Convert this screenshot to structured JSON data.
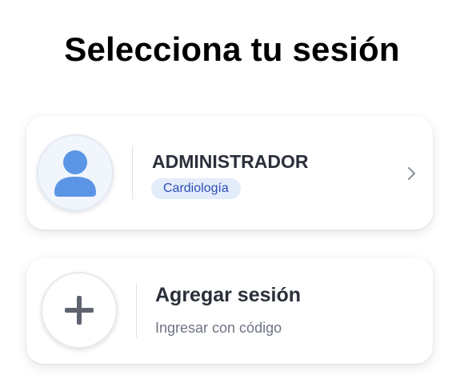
{
  "header": {
    "title": "Selecciona tu sesión"
  },
  "sessions": [
    {
      "name": "ADMINISTRADOR",
      "specialty": "Cardiología",
      "avatar_icon": "user-avatar-icon",
      "chevron_icon": "chevron-right-icon"
    }
  ],
  "add_session": {
    "title": "Agregar sesión",
    "subtitle": "Ingresar con código",
    "icon": "plus-icon"
  },
  "colors": {
    "avatar_blue": "#5b95e6",
    "badge_bg": "#e2ecfb",
    "badge_text": "#2e4fb8",
    "plus_gray": "#5f6470"
  }
}
